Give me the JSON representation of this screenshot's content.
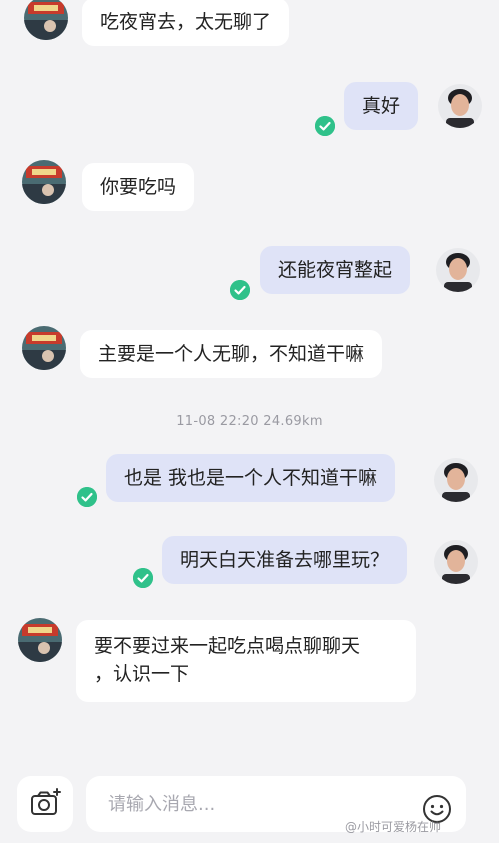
{
  "colors": {
    "background": "#f3f3f5",
    "incoming_bubble": "#ffffff",
    "outgoing_bubble": "#dfe3f7",
    "read_check": "#2fc18a"
  },
  "messages": [
    {
      "side": "in",
      "text": "吃夜宵去，太无聊了"
    },
    {
      "side": "out",
      "text": "真好"
    },
    {
      "side": "in",
      "text": "你要吃吗"
    },
    {
      "side": "out",
      "text": "还能夜宵整起"
    },
    {
      "side": "in",
      "text": "主要是一个人无聊，不知道干嘛"
    },
    {
      "side": "out",
      "text": "也是 我也是一个人不知道干嘛"
    },
    {
      "side": "out",
      "text": "明天白天准备去哪里玩？"
    },
    {
      "side": "in",
      "text_line1": "要不要过来一起吃点喝点聊聊天",
      "text_line2": "，认识一下"
    }
  ],
  "timestamp": "11-08 22:20 24.69km",
  "input": {
    "placeholder": "请输入消息..."
  },
  "icons": {
    "camera": "camera-icon",
    "emoji": "emoji-icon",
    "read": "check-icon"
  },
  "watermark": "@小时可爱杨在帅"
}
